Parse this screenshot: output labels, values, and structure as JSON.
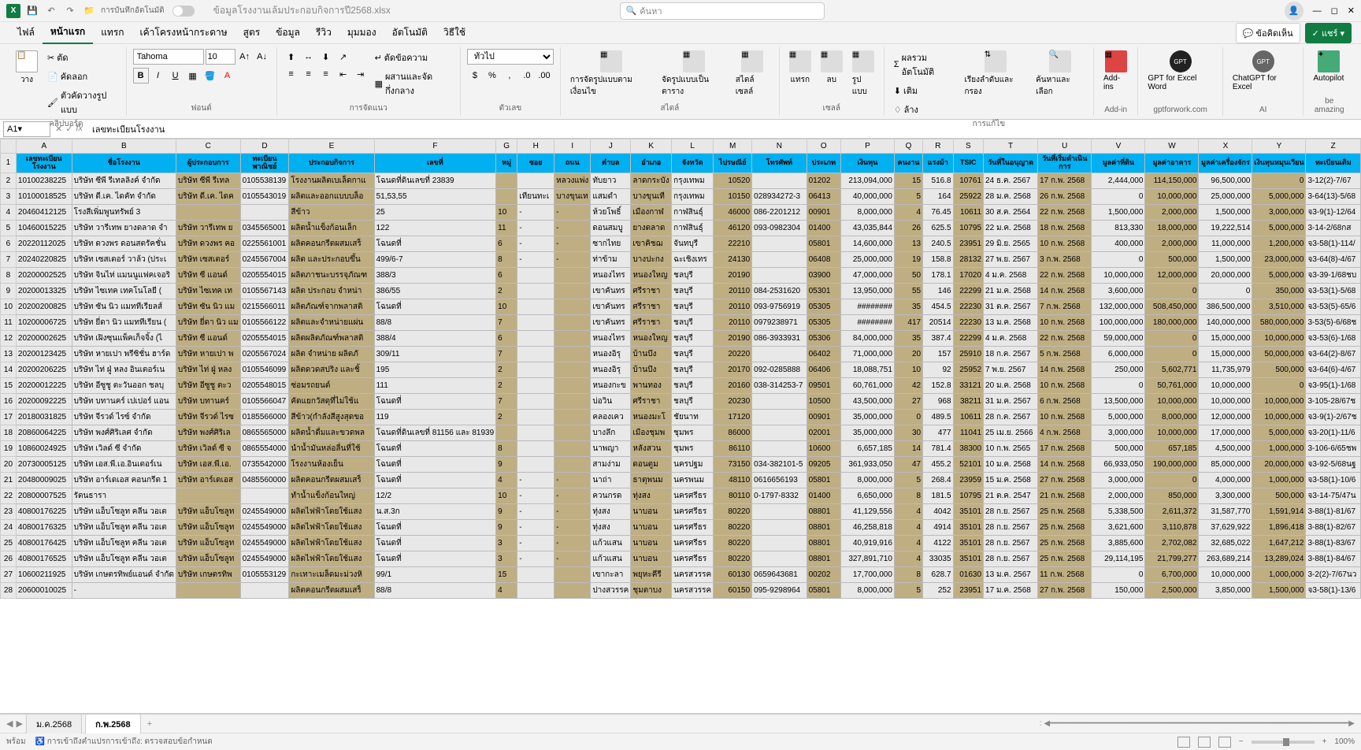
{
  "titlebar": {
    "autosave_label": "การบันทึกอัตโนมัติ",
    "filename": "ข้อมูลโรงงานเล้มประกอบกิจการปี2568.xlsx",
    "search_placeholder": "ค้นหา"
  },
  "ribbonTabs": [
    "ไฟล์",
    "หน้าแรก",
    "แทรก",
    "เค้าโครงหน้ากระดาษ",
    "สูตร",
    "ข้อมูล",
    "รีวิว",
    "มุมมอง",
    "อัตโนมัติ",
    "วิธีใช้"
  ],
  "ribbonRight": {
    "comments": "ข้อคิดเห็น",
    "share": "แชร์"
  },
  "ribbon": {
    "clipboard": {
      "paste": "วาง",
      "cut": "ตัด",
      "copy": "คัดลอก",
      "format": "ตัวคัดวางรูปแบบ",
      "label": "คลิปบอร์ด"
    },
    "font": {
      "name": "Tahoma",
      "size": "10",
      "label": "ฟอนต์"
    },
    "alignment": {
      "wrap": "ตัดข้อความ",
      "merge": "ผสานและจัดกึ่งกลาง",
      "label": "การจัดแนว"
    },
    "number": {
      "general": "ทั่วไป",
      "label": "ตัวเลข"
    },
    "styles": {
      "cond": "การจัดรูปแบบตามเงื่อนไข",
      "table": "จัดรูปแบบเป็นตาราง",
      "cell": "สไตล์เซลล์",
      "label": "สไตล์"
    },
    "cells": {
      "insert": "แทรก",
      "delete": "ลบ",
      "format": "รูปแบบ",
      "label": "เซลล์"
    },
    "editing": {
      "sum": "ผลรวมอัตโนมัติ",
      "fill": "เติม",
      "clear": "ล้าง",
      "sort": "เรียงลำดับและกรอง",
      "find": "ค้นหาและเลือก",
      "label": "การแก้ไข"
    },
    "addins": {
      "addins": "Add-ins",
      "gptword": "GPT for Excel Word",
      "chatgpt": "ChatGPT for Excel",
      "autopilot": "Autopilot",
      "l1": "Add-in",
      "l2": "gptforwork.com",
      "l3": "AI",
      "l4": "be amazing"
    }
  },
  "formulaBar": {
    "cell": "A1",
    "value": "เลขทะเบียนโรงงาน"
  },
  "columns": [
    "A",
    "B",
    "C",
    "D",
    "E",
    "F",
    "G",
    "H",
    "I",
    "J",
    "K",
    "L",
    "M",
    "N",
    "O",
    "P",
    "Q",
    "R",
    "S",
    "T",
    "U",
    "V",
    "W",
    "X",
    "Y",
    "Z"
  ],
  "header": [
    "เลขทะเบียนโรงงาน",
    "ชื่อโรงงาน",
    "ผู้ประกอบการ",
    "ทะเบียนพาณิชย์",
    "ประกอบกิจการ",
    "เลขที่",
    "หมู่",
    "ซอย",
    "ถนน",
    "ตำบล",
    "อำเภอ",
    "จังหวัด",
    "ไปรษณีย์",
    "โทรศัพท์",
    "ประเภท",
    "เงินทุน",
    "คนงาน",
    "แรงม้า",
    "TSIC",
    "วันที่ในอนุญาต",
    "วันที่เริ่มดำเนินการ",
    "มูลค่าที่ดิน",
    "มูลค่าอาคาร",
    "มูลค่าเครื่องจักร",
    "เงินทุนหมุนเวียน",
    "ทะเบียนเดิม"
  ],
  "rows": [
    [
      "10100238225",
      "บริษัท ซีพี รีเทลลิงค์ จำกัด",
      "บริษัท ซีพี รีเทล",
      "0105538139",
      "โรงงานผลิตเบเล็ดกาแ",
      "โฉนดที่ดินเลขที่ 23839",
      "",
      "",
      "หลวงแพ่ง",
      "ทับยาว",
      "ลาดกระบัง",
      "กรุงเทพม",
      "10520",
      "",
      "01202",
      "213,094,000",
      "15",
      "516.8",
      "10761",
      "24 ธ.ค. 2567",
      "17 ก.พ. 2568",
      "2,444,000",
      "114,150,000",
      "96,500,000",
      "0",
      "3-12(2)-7/67"
    ],
    [
      "10100018525",
      "บริษัท ดี.เค. ไดคัท จำกัด",
      "บริษัท ดี.เค. ไดค",
      "0105543019",
      "ผลิตและออกแบบบล็อ",
      "51,53,55",
      "",
      "เทียนทะเ",
      "บางขุนเท",
      "แสมดำ",
      "บางขุนเที",
      "กรุงเทพม",
      "10150",
      "028934272-3",
      "06413",
      "40,000,000",
      "5",
      "164",
      "25922",
      "28 ม.ค. 2568",
      "26 ก.พ. 2568",
      "0",
      "10,000,000",
      "25,000,000",
      "5,000,000",
      "3-64(13)-5/68"
    ],
    [
      "20460412125",
      "โรงสีเพิ่มพูนทรัพย์ 3",
      "",
      "",
      "สีข้าว",
      "25",
      "10",
      "-",
      "-",
      "ห้วยโพธิ์",
      "เมืองกาฬ",
      "กาฬสินธุ์",
      "46000",
      "086-2201212",
      "00901",
      "8,000,000",
      "4",
      "76.45",
      "10611",
      "30 ส.ค. 2564",
      "22 ก.พ. 2568",
      "1,500,000",
      "2,000,000",
      "1,500,000",
      "3,000,000",
      "จ3-9(1)-12/64"
    ],
    [
      "10460015225",
      "บริษัท วารีเทพ ยางดลาด จำ",
      "บริษัท วารีเทพ ย",
      "0345565001",
      "ผลิตน้ำแข็งก้อนเล็ก",
      "122",
      "11",
      "-",
      "-",
      "ดอนสมบู",
      "ยางดลาด",
      "กาฬสินธุ์",
      "46120",
      "093-0982304",
      "01400",
      "43,035,844",
      "26",
      "625.5",
      "10795",
      "22 ม.ค. 2568",
      "18 ก.พ. 2568",
      "813,330",
      "18,000,000",
      "19,222,514",
      "5,000,000",
      "3-14-2/68กส"
    ],
    [
      "20220112025",
      "บริษัท ดวงพร ดอนสตรัคชั่น",
      "บริษัท ดวงพร คอ",
      "0225561001",
      "ผลิตคอนกรีตผสมเสร็",
      "โฉนดที่",
      "6",
      "-",
      "-",
      "ซากไทย",
      "เขาคิชฌ",
      "จันทบุรี",
      "22210",
      "",
      "05801",
      "14,600,000",
      "13",
      "240.5",
      "23951",
      "29 มิ.ย. 2565",
      "10 ก.พ. 2568",
      "400,000",
      "2,000,000",
      "11,000,000",
      "1,200,000",
      "จ3-58(1)-114/"
    ],
    [
      "20240220825",
      "บริษัท เซสเตอร์ วาล้ว (ประเ",
      "บริษัท เซสเตอร์",
      "0245567004",
      "ผลิต และประกอบขึ้น",
      "499/6-7",
      "8",
      "-",
      "-",
      "ท่าข้าม",
      "บางปะกง",
      "ฉะเชิงเทร",
      "24130",
      "",
      "06408",
      "25,000,000",
      "19",
      "158.8",
      "28132",
      "27 พ.ย. 2567",
      "3 ก.พ. 2568",
      "0",
      "500,000",
      "1,500,000",
      "23,000,000",
      "จ3-64(8)-4/67"
    ],
    [
      "20200002525",
      "บริษัท จินไท่ แมนนูแฟคเจอริ",
      "บริษัท ซี แอนด์ ",
      "0205554015",
      "ผลิตภาชนะบรรจุภัณฑ",
      "388/3",
      "6",
      "",
      "",
      "หนองไทร",
      "หนองใหญ",
      "ชลบุรี",
      "20190",
      "",
      "03900",
      "47,000,000",
      "50",
      "178.1",
      "17020",
      "4 ม.ค. 2568",
      "22 ก.พ. 2568",
      "10,000,000",
      "12,000,000",
      "20,000,000",
      "5,000,000",
      "จ3-39-1/68ชบ"
    ],
    [
      "20200013325",
      "บริษัท ไซเทค เทคโนโลยี (",
      "บริษัท ไซเทค เท",
      "0105567143",
      "ผลิต ประกอบ จำหน่า",
      "386/55",
      "2",
      "",
      "",
      "เขาคันทร",
      "ศรีราชา",
      "ชลบุรี",
      "20110",
      "084-2531620",
      "05301",
      "13,950,000",
      "55",
      "146",
      "22299",
      "21 ม.ค. 2568",
      "14 ก.พ. 2568",
      "3,600,000",
      "0",
      "0",
      "350,000",
      "จ3-53(1)-5/68"
    ],
    [
      "20200200825",
      "บริษัท ซัน นิว แมททีเรียลส์",
      "บริษัท ซัน นิว แม",
      "0215566011",
      "ผลิตภัณฑ์จากพลาสติ",
      "โฉนดที่",
      "10",
      "",
      "",
      "เขาคันทร",
      "ศรีราชา",
      "ชลบุรี",
      "20110",
      "093-9756919",
      "05305",
      "########",
      "35",
      "454.5",
      "22230",
      "31 ต.ค. 2567",
      "7 ก.พ. 2568",
      "132,000,000",
      "508,450,000",
      "386,500,000",
      "3,510,000",
      "จ3-53(5)-65/6"
    ],
    [
      "10200006725",
      "บริษัท ยี่ดา นิว แมททีเรียน (",
      "บริษัท ยี่ดา นิว แม",
      "0105566122",
      "ผลิตและจำหน่ายแผ่น",
      "88/8",
      "7",
      "",
      "",
      "เขาคันทร",
      "ศรีราชา",
      "ชลบุรี",
      "20110",
      "0979238971",
      "05305",
      "########",
      "417",
      "20514",
      "22230",
      "13 ม.ค. 2568",
      "10 ก.พ. 2568",
      "100,000,000",
      "180,000,000",
      "140,000,000",
      "580,000,000",
      "3-53(5)-6/68ช"
    ],
    [
      "20200002625",
      "บริษัท เฝิงซุนแพ็คเก็จจิ้ง (ไ",
      "บริษัท ซี แอนด์ ",
      "0205554015",
      "ผลิตผลิตภัณฑ์พลาสติ",
      "388/4",
      "6",
      "",
      "",
      "หนองไทร",
      "หนองใหญ",
      "ชลบุรี",
      "20190",
      "086-3933931",
      "05306",
      "84,000,000",
      "35",
      "387.4",
      "22299",
      "4 ม.ค. 2568",
      "22 ก.พ. 2568",
      "59,000,000",
      "0",
      "15,000,000",
      "10,000,000",
      "จ3-53(6)-1/68"
    ],
    [
      "20200123425",
      "บริษัท หายเปา พรีซิชั่น ฮาร์ด",
      "บริษัท หายเปา พ",
      "0205567024",
      "ผลิต จำหน่าย ผลิตภั",
      "309/11",
      "7",
      "",
      "",
      "หนองอิรุ",
      "บ้านบึง",
      "ชลบุรี",
      "20220",
      "",
      "06402",
      "71,000,000",
      "20",
      "157",
      "25910",
      "18 ก.ค. 2567",
      "5 ก.พ. 2568",
      "6,000,000",
      "0",
      "15,000,000",
      "50,000,000",
      "จ3-64(2)-8/67"
    ],
    [
      "20200206225",
      "บริษัท ไท่ ฝู่ หลง อินเตอร์เน",
      "บริษัท ไท่ ฝู่ หลง",
      "0105546099",
      "ผลิตดวดสปริง และชิ้",
      "195",
      "2",
      "",
      "",
      "หนองอิรุ",
      "บ้านบึง",
      "ชลบุรี",
      "20170",
      "092-0285888",
      "06406",
      "18,088,751",
      "10",
      "92",
      "25952",
      "7 พ.ย. 2567",
      "14 ก.พ. 2568",
      "250,000",
      "5,602,771",
      "11,735,979",
      "500,000",
      "จ3-64(6)-4/67"
    ],
    [
      "20200012225",
      "บริษัท อีซูชู ตะวันออก ชลบุ",
      "บริษัท อีซูชู ตะว",
      "0205548015",
      "ซ่อมรถยนต์",
      "111",
      "2",
      "",
      "",
      "หนองกะข",
      "พานทอง",
      "ชลบุรี",
      "20160",
      "038-314253-7",
      "09501",
      "60,761,000",
      "42",
      "152.8",
      "33121",
      "20 ม.ค. 2568",
      "10 ก.พ. 2568",
      "0",
      "50,761,000",
      "10,000,000",
      "0",
      "จ3-95(1)-1/68"
    ],
    [
      "20200092225",
      "บริษัท บทานคร์ เปเปอร์ แอน",
      "บริษัท บทานคร์ ",
      "0105566047",
      "คัดแยกวัสดุที่ไม่ใช้แ",
      "โฉนดที่",
      "7",
      "",
      "",
      "บ่อวิน",
      "ศรีราชา",
      "ชลบุรี",
      "20230",
      "",
      "10500",
      "43,500,000",
      "27",
      "968",
      "38211",
      "31 ม.ค. 2567",
      "6 ก.พ. 2568",
      "13,500,000",
      "10,000,000",
      "10,000,000",
      "10,000,000",
      "3-105-28/67ช"
    ],
    [
      "20180031825",
      "บริษัท จีรวด์ ไรซ์ จำกัด",
      "บริษัท จีรวด์ ไรซ",
      "0185566000",
      "สีข้าว(กำลังสีสูงสุดขอ",
      "119",
      "2",
      "",
      "",
      "คลองเคว",
      "หนองมะโ",
      "ชัยนาท",
      "17120",
      "",
      "00901",
      "35,000,000",
      "0",
      "489.5",
      "10611",
      "28 ก.ค. 2567",
      "10 ก.พ. 2568",
      "5,000,000",
      "8,000,000",
      "12,000,000",
      "10,000,000",
      "จ3-9(1)-2/67ช"
    ],
    [
      "20860064225",
      "บริษัท พงศ์ศิริเลศ จำกัด",
      "บริษัท พงศ์ศิริเล",
      "0865565000",
      "ผลิตน้ำดื่มและขวดพล",
      "โฉนดที่ดินเลขที่ 81156 และ 81939",
      "",
      "",
      "",
      "บางลึก",
      "เมืองชุมพ",
      "ชุมพร",
      "86000",
      "",
      "02001",
      "35,000,000",
      "30",
      "477",
      "11041",
      "25 เม.ย. 2566",
      "4 ก.พ. 2568",
      "3,000,000",
      "10,000,000",
      "17,000,000",
      "5,000,000",
      "จ3-20(1)-11/6"
    ],
    [
      "10860024925",
      "บริษัท เวิลด์ ซี จำกัด",
      "บริษัท เวิลด์ ซี จ",
      "0865554000",
      "นำน้ำมันหล่อลื่นที่ใช้",
      "โฉนดที่",
      "8",
      "",
      "",
      "นาพญา",
      "หลังสวน",
      "ชุมพร",
      "86110",
      "",
      "10600",
      "6,657,185",
      "14",
      "781.4",
      "38300",
      "10 ก.พ. 2565",
      "17 ก.พ. 2568",
      "500,000",
      "657,185",
      "4,500,000",
      "1,000,000",
      "3-106-6/65ชพ"
    ],
    [
      "20730005125",
      "บริษัท เอส.พี.เอ.อินเตอร์เน",
      "บริษัท เอส.พี.เอ.",
      "0735542000",
      "โรงงานห้องเย็น",
      "โฉนดที่",
      "9",
      "",
      "",
      "สามง่าม",
      "ดอนตูม",
      "นครปฐม",
      "73150",
      "034-382101-5",
      "09205",
      "361,933,050",
      "47",
      "455.2",
      "52101",
      "10 ม.ค. 2568",
      "14 ก.พ. 2568",
      "66,933,050",
      "190,000,000",
      "85,000,000",
      "20,000,000",
      "จ3-92-5/68นฐ"
    ],
    [
      "20480009025",
      "บริษัท อาร์เดเอส คอนกรีต 1",
      "บริษัท อาร์เดเอส",
      "0485560000",
      "ผลิตคอนกรีตผสมเสร็",
      "โฉนดที่",
      "4",
      "-",
      "-",
      "นาถ่า",
      "ธาตุพนม",
      "นครพนม",
      "48110",
      "0616656193",
      "05801",
      "8,000,000",
      "5",
      "268.4",
      "23959",
      "15 ม.ค. 2568",
      "27 ก.พ. 2568",
      "3,000,000",
      "0",
      "4,000,000",
      "1,000,000",
      "จ3-58(1)-10/6"
    ],
    [
      "20800007525",
      "รัตนธารา",
      "",
      "",
      "ทำน้ำแข็งก้อนใหญ่",
      "12/2",
      "10",
      "-",
      "-",
      "ควนกรด",
      "ทุ่งสง",
      "นครศรีธร",
      "80110",
      "0-1797-8332",
      "01400",
      "6,650,000",
      "8",
      "181.5",
      "10795",
      "21 ต.ค. 2547",
      "21 ก.พ. 2568",
      "2,000,000",
      "850,000",
      "3,300,000",
      "500,000",
      "จ3-14-75/47น"
    ],
    [
      "40800176225",
      "บริษัท แอ็บโซลูท คลีน วอเต",
      "บริษัท แอ็บโซลูท",
      "0245549000",
      "ผลิตไฟฟ้าโดยใช้แสง",
      "น.ส.3ก",
      "9",
      "-",
      "-",
      "ทุ่งสง",
      "นาบอน",
      "นครศรีธร",
      "80220",
      "",
      "08801",
      "41,129,556",
      "4",
      "4042",
      "35101",
      "28 ก.ย. 2567",
      "25 ก.พ. 2568",
      "5,338,500",
      "2,611,372",
      "31,587,770",
      "1,591,914",
      "3-88(1)-81/67"
    ],
    [
      "40800176325",
      "บริษัท แอ็บโซลูท คลีน วอเต",
      "บริษัท แอ็บโซลูท",
      "0245549000",
      "ผลิตไฟฟ้าโดยใช้แสง",
      "โฉนดที่",
      "9",
      "-",
      "-",
      "ทุ่งสง",
      "นาบอน",
      "นครศรีธร",
      "80220",
      "",
      "08801",
      "46,258,818",
      "4",
      "4914",
      "35101",
      "28 ก.ย. 2567",
      "25 ก.พ. 2568",
      "3,621,600",
      "3,110,878",
      "37,629,922",
      "1,896,418",
      "3-88(1)-82/67"
    ],
    [
      "40800176425",
      "บริษัท แอ็บโซลูท คลีน วอเต",
      "บริษัท แอ็บโซลูท",
      "0245549000",
      "ผลิตไฟฟ้าโดยใช้แสง",
      "โฉนดที่",
      "3",
      "-",
      "-",
      "แก้วแสน",
      "นาบอน",
      "นครศรีธร",
      "80220",
      "",
      "08801",
      "40,919,916",
      "4",
      "4122",
      "35101",
      "28 ก.ย. 2567",
      "25 ก.พ. 2568",
      "3,885,600",
      "2,702,082",
      "32,685,022",
      "1,647,212",
      "3-88(1)-83/67"
    ],
    [
      "40800176525",
      "บริษัท แอ็บโซลูท คลีน วอเต",
      "บริษัท แอ็บโซลูท",
      "0245549000",
      "ผลิตไฟฟ้าโดยใช้แสง",
      "โฉนดที่",
      "3",
      "-",
      "-",
      "แก้วแสน",
      "นาบอน",
      "นครศรีธร",
      "80220",
      "",
      "08801",
      "327,891,710",
      "4",
      "33035",
      "35101",
      "28 ก.ย. 2567",
      "25 ก.พ. 2568",
      "29,114,195",
      "21,799,277",
      "263,689,214",
      "13,289,024",
      "3-88(1)-84/67"
    ],
    [
      "10600211925",
      "บริษัท เกษตรทิพย์แอนด์ จำกัด",
      "บริษัท เกษตรทิพ",
      "0105553129",
      "กะเทาะเมล็ดมะม่วงหิ",
      "99/1",
      "15",
      "",
      "",
      "เขากะลา",
      "พยุหะคีรี",
      "นครสวรรค",
      "60130",
      "0659643681",
      "00202",
      "17,700,000",
      "8",
      "628.7",
      "01630",
      "13 ม.ค. 2567",
      "11 ก.พ. 2568",
      "0",
      "6,700,000",
      "10,000,000",
      "1,000,000",
      "3-2(2)-7/67นว"
    ],
    [
      "20600010025",
      "-",
      "",
      "",
      "ผลิตคอนกรีตผสมเสร็",
      "88/8",
      "4",
      "",
      "",
      "ปางสวรรค",
      "ชุมตาบง",
      "นครสวรรค",
      "60150",
      "095-9298964",
      "05801",
      "8,000,000",
      "5",
      "252",
      "23951",
      "17 ม.ค. 2568",
      "27 ก.พ. 2568",
      "150,000",
      "2,500,000",
      "3,850,000",
      "1,500,000",
      "จ3-58(1)-13/6"
    ]
  ],
  "sheetTabs": [
    "ม.ค.2568",
    "ก.พ.2568"
  ],
  "status": {
    "ready": "พร้อม",
    "access": "การเข้าถึงคำแปรการเข้าถึง: ตรวจสอบข้อกำหนด",
    "zoom": "100%"
  }
}
